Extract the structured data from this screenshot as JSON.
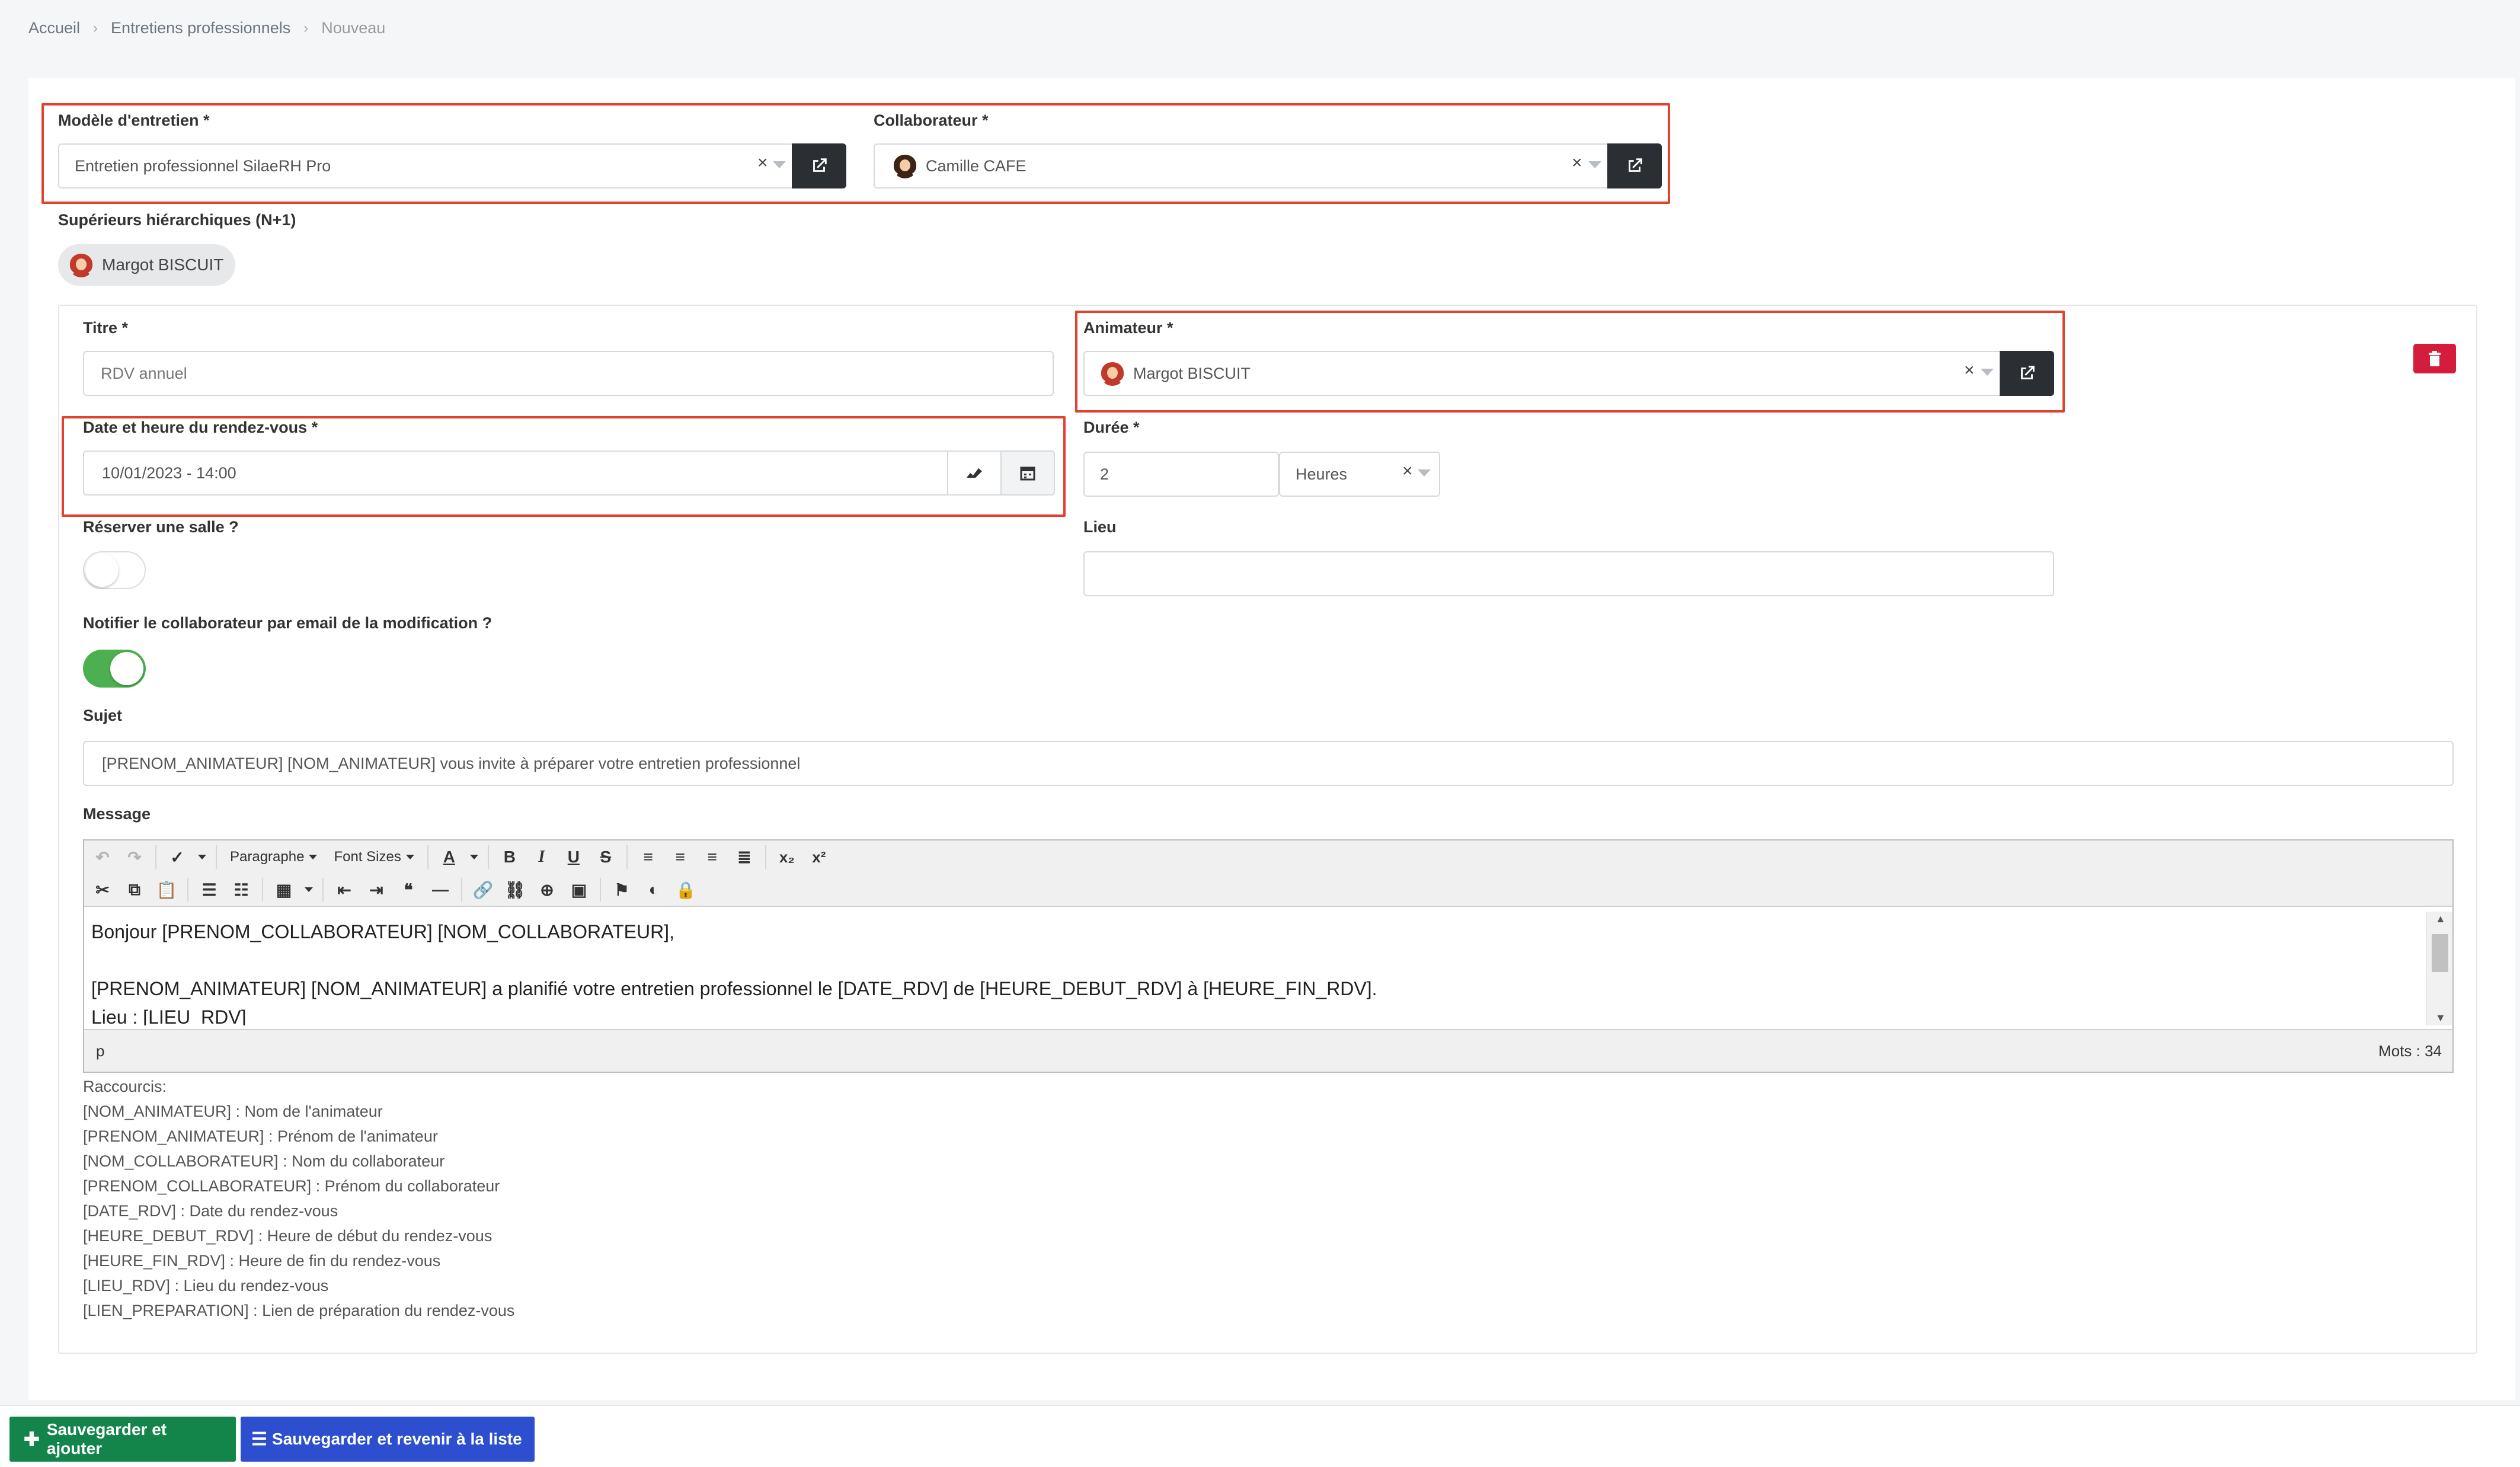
{
  "breadcrumb": {
    "items": [
      "Accueil",
      "Entretiens professionnels",
      "Nouveau"
    ]
  },
  "form": {
    "modele": {
      "label": "Modèle d'entretien *",
      "value": "Entretien professionnel SilaeRH Pro"
    },
    "collaborateur": {
      "label": "Collaborateur *",
      "value": "Camille CAFE"
    },
    "superieurs": {
      "label": "Supérieurs hiérarchiques (N+1)",
      "chip": "Margot BISCUIT"
    },
    "titre": {
      "label": "Titre *",
      "placeholder": "RDV annuel"
    },
    "animateur": {
      "label": "Animateur *",
      "value": "Margot BISCUIT"
    },
    "date": {
      "label": "Date et heure du rendez-vous *",
      "value": "10/01/2023 - 14:00"
    },
    "duree": {
      "label": "Durée *",
      "value": "2",
      "unit": "Heures"
    },
    "salle": {
      "label": "Réserver une salle ?",
      "on": false
    },
    "lieu": {
      "label": "Lieu",
      "value": ""
    },
    "notifier": {
      "label": "Notifier le collaborateur par email de la modification ?",
      "on": true
    },
    "sujet": {
      "label": "Sujet",
      "value": "[PRENOM_ANIMATEUR] [NOM_ANIMATEUR] vous invite à préparer votre entretien professionnel"
    },
    "message": {
      "label": "Message",
      "toolbar": {
        "format": "Paragraphe",
        "font_sizes": "Font Sizes"
      },
      "lines": [
        "Bonjour [PRENOM_COLLABORATEUR] [NOM_COLLABORATEUR],",
        "",
        "[PRENOM_ANIMATEUR] [NOM_ANIMATEUR] a planifié votre entretien professionnel le [DATE_RDV] de [HEURE_DEBUT_RDV] à [HEURE_FIN_RDV].",
        "Lieu : [LIEU_RDV]"
      ],
      "status_path": "p",
      "word_count": "Mots : 34"
    },
    "raccourcis": {
      "title": "Raccourcis:",
      "items": [
        "[NOM_ANIMATEUR] : Nom de l'animateur",
        "[PRENOM_ANIMATEUR] : Prénom de l'animateur",
        "[NOM_COLLABORATEUR] : Nom du collaborateur",
        "[PRENOM_COLLABORATEUR] : Prénom du collaborateur",
        "[DATE_RDV] : Date du rendez-vous",
        "[HEURE_DEBUT_RDV] : Heure de début du rendez-vous",
        "[HEURE_FIN_RDV] : Heure de fin du rendez-vous",
        "[LIEU_RDV] : Lieu du rendez-vous",
        "[LIEN_PREPARATION] : Lien de préparation du rendez-vous"
      ]
    }
  },
  "actions": {
    "save_add": "Sauvegarder et ajouter",
    "save_list": "Sauvegarder et revenir à la liste"
  },
  "colors": {
    "highlight": "#e0422f",
    "toggle_on": "#4caf50",
    "delete": "#d41c3c",
    "btn_green": "#13854b",
    "btn_blue": "#2c4ecf"
  }
}
